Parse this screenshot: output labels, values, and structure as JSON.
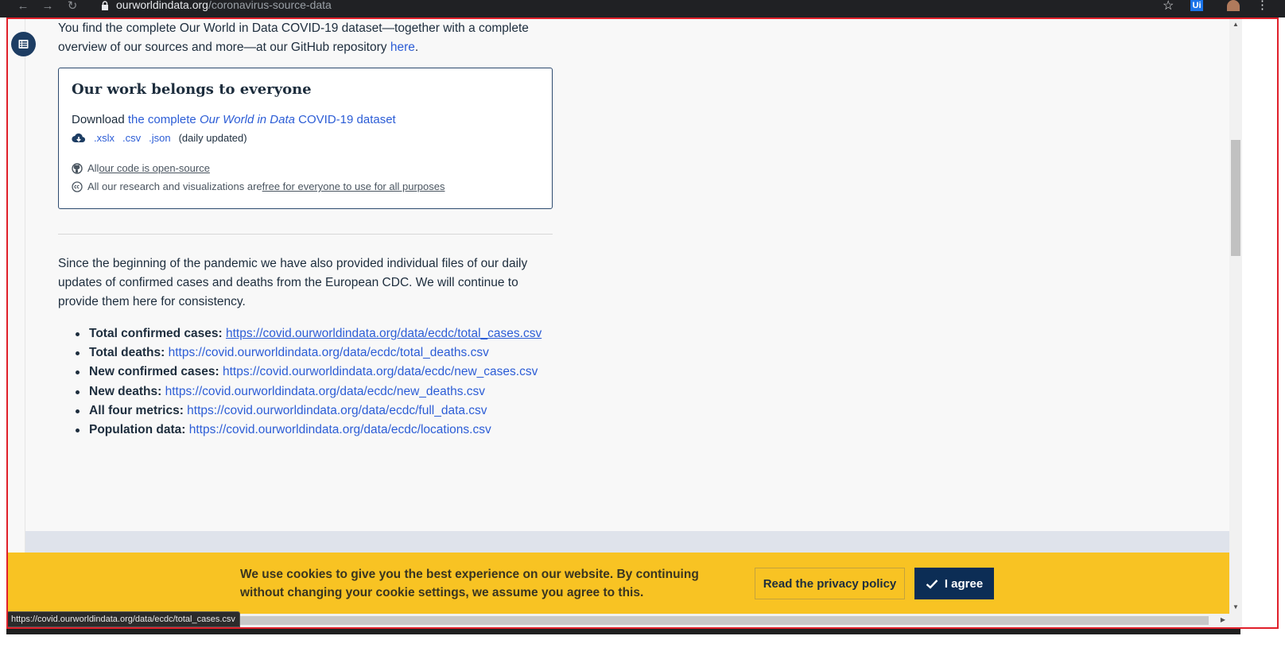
{
  "browser": {
    "url_host": "ourworldindata.org",
    "url_path": "/coronavirus-source-data",
    "extension_label": "Ui"
  },
  "intro": {
    "text": "You find the complete Our World in Data COVID-19 dataset—together with a complete overview of our sources and more—at our GitHub repository ",
    "link": "here",
    "end": "."
  },
  "cta": {
    "title": "Our work belongs to everyone",
    "download_prefix": "Download ",
    "download_link_a": "the complete ",
    "download_link_em": "Our World in Data",
    "download_link_b": " COVID-19 dataset",
    "format_xlsx": ".xslx",
    "format_csv": ".csv",
    "format_json": ".json",
    "daily_note": "(daily updated)",
    "code_prefix": "All ",
    "code_link": "our code is open-source",
    "cc_prefix": "All our research and visualizations are ",
    "cc_link": "free for everyone to use for all purposes"
  },
  "paragraph": "Since the beginning of the pandemic we have also provided individual files of our daily updates of confirmed cases and deaths from the European CDC. We will continue to provide them here for consistency.",
  "links": [
    {
      "label": "Total confirmed cases:",
      "url": "https://covid.ourworldindata.org/data/ecdc/total_cases.csv"
    },
    {
      "label": "Total deaths:",
      "url": "https://covid.ourworldindata.org/data/ecdc/total_deaths.csv"
    },
    {
      "label": "New confirmed cases:",
      "url": "https://covid.ourworldindata.org/data/ecdc/new_cases.csv"
    },
    {
      "label": "New deaths:",
      "url": "https://covid.ourworldindata.org/data/ecdc/new_deaths.csv"
    },
    {
      "label": "All four metrics:",
      "url": "https://covid.ourworldindata.org/data/ecdc/full_data.csv"
    },
    {
      "label": "Population data:",
      "url": "https://covid.ourworldindata.org/data/ecdc/locations.csv"
    }
  ],
  "cookie": {
    "text": "We use cookies to give you the best experience on our website. By continuing without changing your cookie settings, we assume you agree to this.",
    "privacy_button": "Read the privacy policy",
    "agree_button": "I agree"
  },
  "status_url": "https://covid.ourworldindata.org/data/ecdc/total_cases.csv",
  "icons": {
    "toc": "table-of-contents-icon",
    "download": "cloud-download-icon",
    "github": "github-icon",
    "cc": "creative-commons-icon",
    "check": "check-icon"
  },
  "colors": {
    "link": "#2c5dd6",
    "banner": "#f8c323",
    "agree_bg": "#0c2d55",
    "toc_bg": "#1d3d63"
  }
}
